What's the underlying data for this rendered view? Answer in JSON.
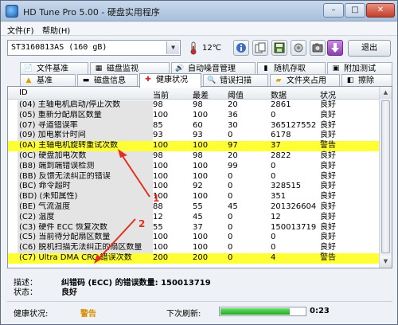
{
  "window": {
    "title": "HD Tune Pro 5.00 - 硬盘实用程序",
    "controls": {
      "minimize": "–",
      "maximize": "□",
      "close": "✕"
    }
  },
  "menubar": {
    "file": "文件(F)",
    "help": "帮助(H)"
  },
  "toolbar": {
    "drive": "ST3160813AS (160 gB)",
    "temperature": "12℃",
    "exit_label": "退出"
  },
  "tabs_top": [
    "文件基准",
    "磁盘监视",
    "自动噪音管理",
    "随机存取",
    "附加测试"
  ],
  "tabs_bottom": [
    "基准",
    "磁盘信息",
    "健康状况",
    "错误扫描",
    "文件夹占用",
    "擦除"
  ],
  "table": {
    "headers": {
      "id": "ID",
      "current": "当前",
      "worst": "最差",
      "threshold": "阈值",
      "data": "数据",
      "status": "状况"
    },
    "rows": [
      {
        "id": "(04) 主轴电机启动/停止次数",
        "current": "98",
        "worst": "98",
        "threshold": "20",
        "data": "2861",
        "status": "良好",
        "warn": false
      },
      {
        "id": "(05) 重新分配扇区数量",
        "current": "100",
        "worst": "100",
        "threshold": "36",
        "data": "0",
        "status": "良好",
        "warn": false
      },
      {
        "id": "(07) 寻道错误率",
        "current": "85",
        "worst": "60",
        "threshold": "30",
        "data": "365127552",
        "status": "良好",
        "warn": false
      },
      {
        "id": "(09) 加电累计时间",
        "current": "93",
        "worst": "93",
        "threshold": "0",
        "data": "6178",
        "status": "良好",
        "warn": false
      },
      {
        "id": "(0A) 主轴电机旋转重试次数",
        "current": "100",
        "worst": "100",
        "threshold": "97",
        "data": "37",
        "status": "警告",
        "warn": true
      },
      {
        "id": "(0C) 硬盘加电次数",
        "current": "98",
        "worst": "98",
        "threshold": "20",
        "data": "2822",
        "status": "良好",
        "warn": false
      },
      {
        "id": "(B8) 端到端错误检测",
        "current": "100",
        "worst": "100",
        "threshold": "99",
        "data": "0",
        "status": "良好",
        "warn": false
      },
      {
        "id": "(BB) 反馈无法纠正的错误",
        "current": "100",
        "worst": "100",
        "threshold": "0",
        "data": "0",
        "status": "良好",
        "warn": false
      },
      {
        "id": "(BC) 命令超时",
        "current": "100",
        "worst": "92",
        "threshold": "0",
        "data": "328515",
        "status": "良好",
        "warn": false
      },
      {
        "id": "(BD) (未知属性)",
        "current": "100",
        "worst": "100",
        "threshold": "0",
        "data": "351",
        "status": "良好",
        "warn": false
      },
      {
        "id": "(BE) 气流温度",
        "current": "88",
        "worst": "55",
        "threshold": "45",
        "data": "201326604",
        "status": "良好",
        "warn": false
      },
      {
        "id": "(C2) 温度",
        "current": "12",
        "worst": "45",
        "threshold": "0",
        "data": "12",
        "status": "良好",
        "warn": false
      },
      {
        "id": "(C3) 硬件 ECC 恢复次数",
        "current": "55",
        "worst": "37",
        "threshold": "0",
        "data": "150013719",
        "status": "良好",
        "warn": false
      },
      {
        "id": "(C5) 当前待分配扇区数量",
        "current": "100",
        "worst": "100",
        "threshold": "0",
        "data": "0",
        "status": "良好",
        "warn": false
      },
      {
        "id": "(C6) 脱机扫描无法纠正的扇区数量",
        "current": "100",
        "worst": "100",
        "threshold": "0",
        "data": "0",
        "status": "良好",
        "warn": false
      },
      {
        "id": "(C7) Ultra DMA CRC 错误次数",
        "current": "200",
        "worst": "200",
        "threshold": "0",
        "data": "4",
        "status": "警告",
        "warn": true
      }
    ]
  },
  "annotations": {
    "label_1": "1",
    "label_2": "2",
    "color": "#e03020"
  },
  "info": {
    "desc_label": "描述：",
    "desc_value": "纠错码 (ECC) 的错误数量: 150013719",
    "state_label": "状态：",
    "state_value": "良好"
  },
  "statusbar": {
    "health_label": "健康状况:",
    "health_value": "警告",
    "refresh_label": "下次刷新:",
    "refresh_progress": 0.82,
    "timer": "0:23"
  }
}
